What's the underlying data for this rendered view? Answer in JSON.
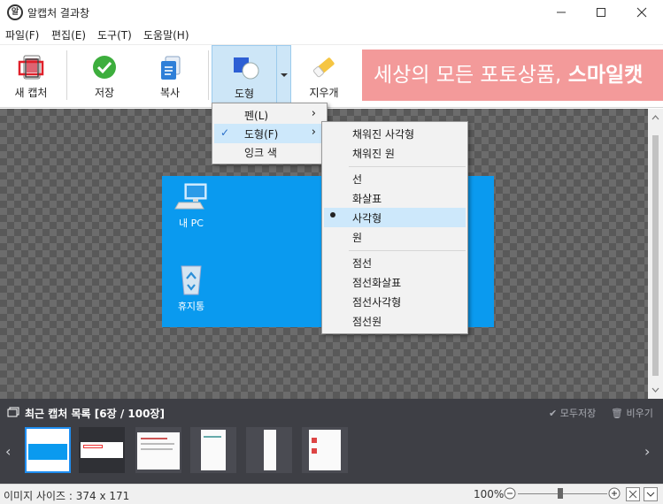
{
  "window": {
    "title": "알캡처 결과창",
    "app_icon": "알"
  },
  "menubar": {
    "items": [
      "파일(F)",
      "편집(E)",
      "도구(T)",
      "도움말(H)"
    ]
  },
  "toolbar": {
    "new_capture": "새 캡처",
    "save": "저장",
    "copy": "복사",
    "shape": "도형",
    "eraser": "지우개",
    "ad": {
      "text_normal": "세상의 모든 포토상품, ",
      "text_bold": "스마일캣"
    }
  },
  "desktop": {
    "icons": [
      {
        "label": "내 PC",
        "icon": "computer-icon"
      },
      {
        "label": "휴지통",
        "icon": "recycle-bin-icon"
      }
    ]
  },
  "tool_menu": {
    "items": [
      {
        "label": "펜(L)",
        "has_submenu": true
      },
      {
        "label": "도형(F)",
        "has_submenu": true,
        "checked": true
      },
      {
        "label": "잉크 색",
        "has_submenu": false
      }
    ]
  },
  "shape_submenu": {
    "groups": [
      [
        "채워진 사각형",
        "채워진 원"
      ],
      [
        "선",
        "화살표",
        "사각형",
        "원"
      ],
      [
        "점선",
        "점선화살표",
        "점선사각형",
        "점선원"
      ]
    ],
    "selected": "사각형"
  },
  "recent": {
    "title": "최근 캡처 목록 [6장 / 100장]",
    "save_all": "모두저장",
    "clear": "비우기",
    "thumb_count": 6
  },
  "status": {
    "image_size": "이미지 사이즈 : 374 x 171",
    "zoom": "100%"
  },
  "colors": {
    "accent": "#0a9aef",
    "recent_bg": "#3e3f45",
    "ad_bg": "#f39a9a",
    "highlight": "#cde8fb"
  }
}
